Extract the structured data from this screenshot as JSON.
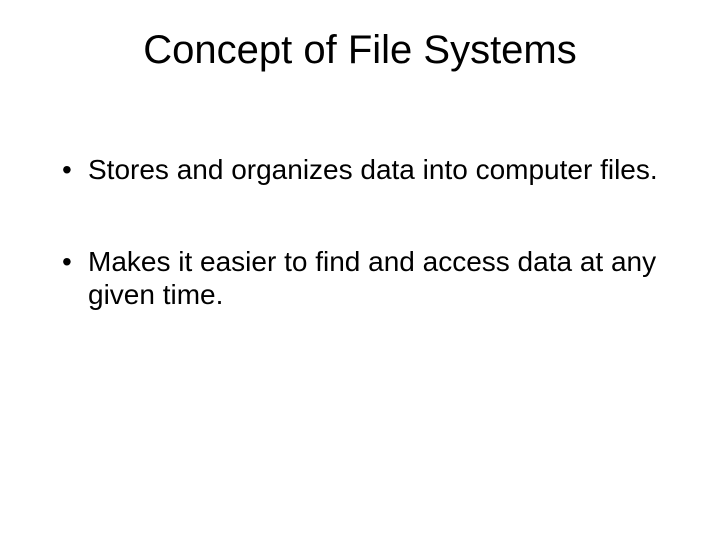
{
  "title": "Concept of File Systems",
  "bullets": [
    "Stores and organizes data into computer files.",
    "Makes it easier to find and access data at any given time."
  ]
}
